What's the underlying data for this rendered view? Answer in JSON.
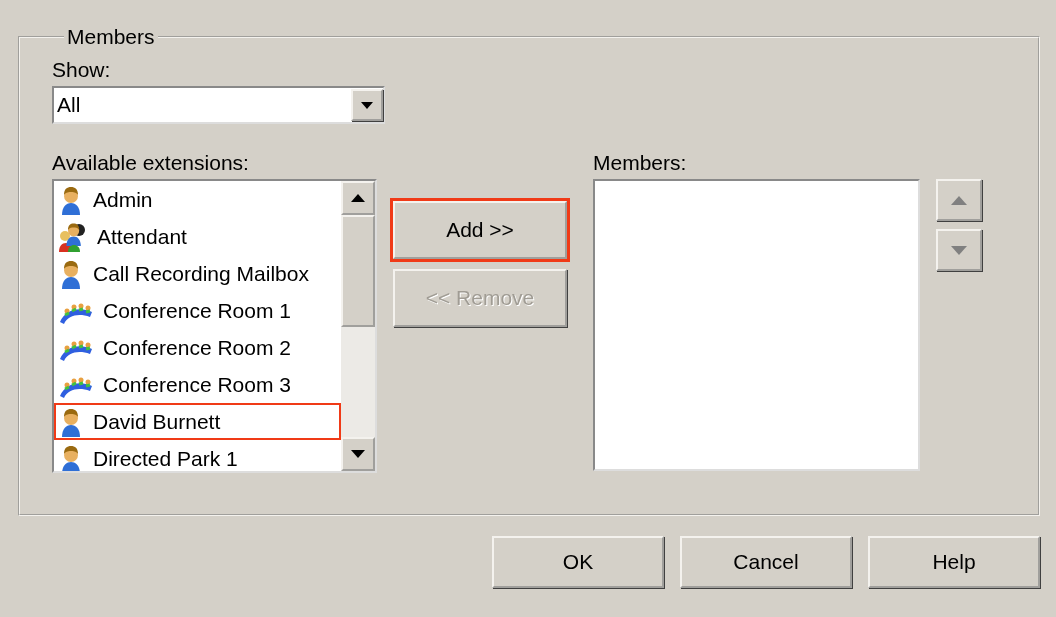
{
  "group": {
    "title": "Members"
  },
  "show": {
    "label": "Show:",
    "value": "All"
  },
  "available": {
    "label": "Available extensions:",
    "items": [
      {
        "text": "Admin",
        "kind": "user",
        "highlighted": false
      },
      {
        "text": "Attendant",
        "kind": "group",
        "highlighted": false
      },
      {
        "text": "Call Recording Mailbox",
        "kind": "user",
        "highlighted": false
      },
      {
        "text": "Conference Room 1",
        "kind": "conference",
        "highlighted": false
      },
      {
        "text": "Conference Room 2",
        "kind": "conference",
        "highlighted": false
      },
      {
        "text": "Conference Room 3",
        "kind": "conference",
        "highlighted": false
      },
      {
        "text": "David Burnett",
        "kind": "user",
        "highlighted": true
      },
      {
        "text": "Directed Park 1",
        "kind": "user",
        "highlighted": false
      }
    ]
  },
  "add_button": {
    "label": "Add >>",
    "highlighted": true,
    "disabled": false
  },
  "remove_button": {
    "label": "<< Remove",
    "highlighted": false,
    "disabled": true
  },
  "members": {
    "label": "Members:"
  },
  "footer_buttons": [
    {
      "label": "OK"
    },
    {
      "label": "Cancel"
    },
    {
      "label": "Help"
    }
  ]
}
